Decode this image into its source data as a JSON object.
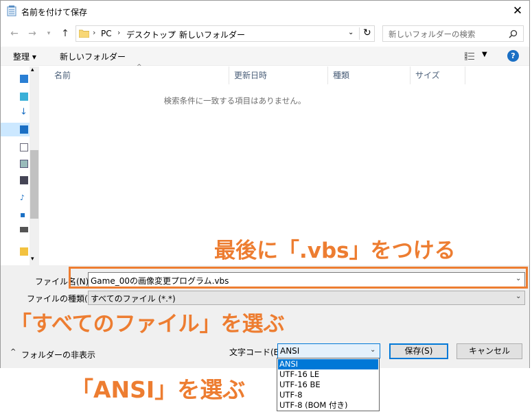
{
  "window": {
    "title": "名前を付けて保存"
  },
  "address": {
    "crumbs": [
      "PC",
      "デスクトップ",
      "新しいフォルダー"
    ]
  },
  "search": {
    "placeholder": "新しいフォルダーの検索"
  },
  "toolbar": {
    "organize_label": "整理 ▾",
    "new_folder_label": "新しいフォルダー"
  },
  "list": {
    "columns": [
      "名前",
      "更新日時",
      "種類",
      "サイズ"
    ],
    "empty_message": "検索条件に一致する項目はありません。"
  },
  "form": {
    "filename_label": "ファイル名(N):",
    "filename_value": "Game_00の画像変更プログラム.vbs",
    "filetype_label": "ファイルの種類(T):",
    "filetype_value": "すべてのファイル (*.*)",
    "hide_folders_label": "フォルダーの非表示",
    "encoding_label": "文字コード(E):",
    "encoding_value": "ANSI",
    "encoding_options": [
      "ANSI",
      "UTF-16 LE",
      "UTF-16 BE",
      "UTF-8",
      "UTF-8 (BOM 付き)"
    ],
    "save_label": "保存(S)",
    "cancel_label": "キャンセル"
  },
  "annotations": {
    "filename_note": "最後に「.vbs」をつける",
    "filetype_note": "「すべてのファイル」を選ぶ",
    "encoding_note": "「ANSI」を選ぶ"
  },
  "colors": {
    "annotation": "#ed7d31",
    "accent": "#0078d7"
  }
}
